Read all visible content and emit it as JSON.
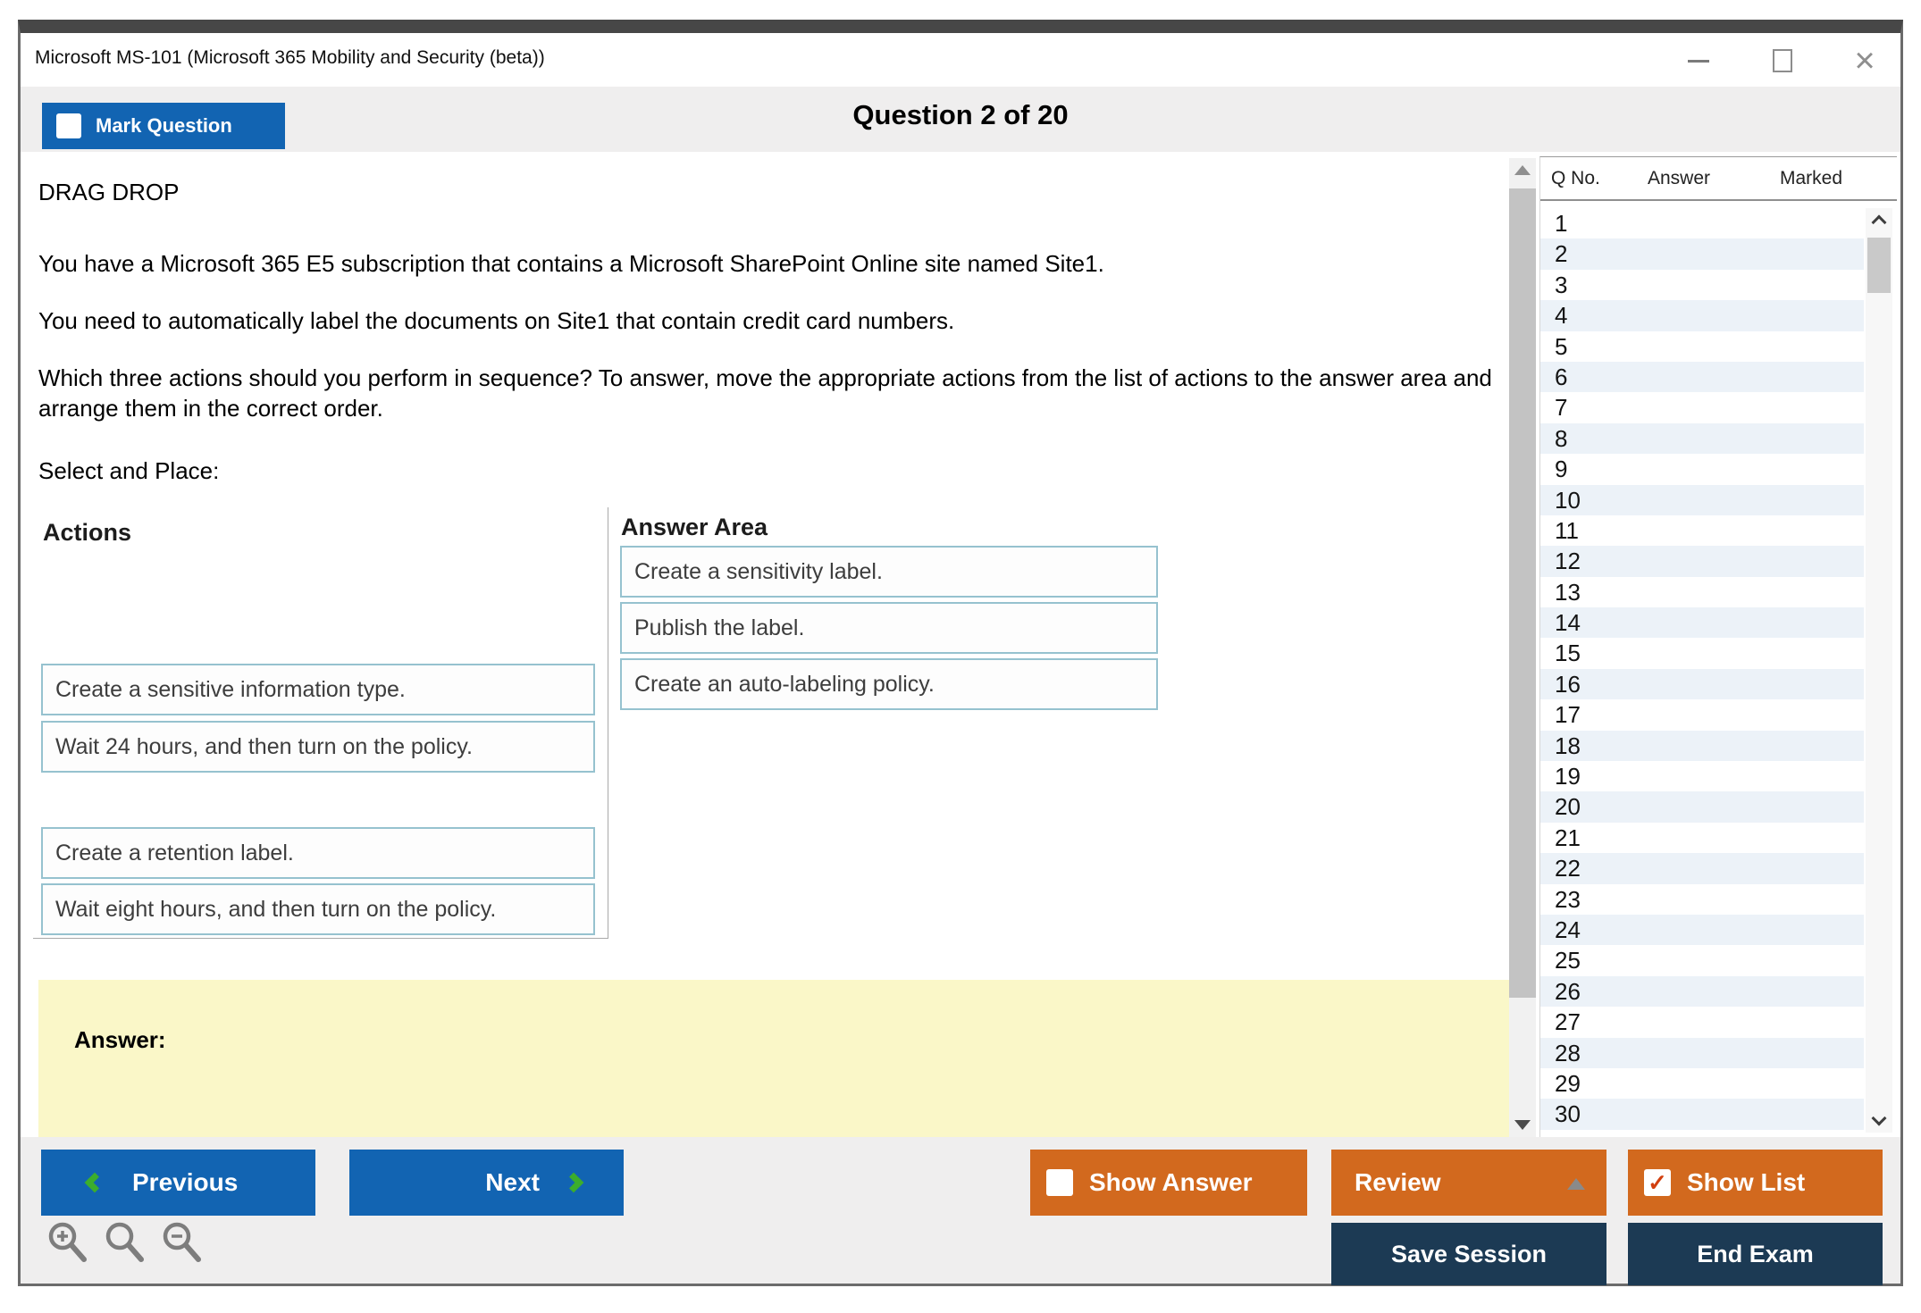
{
  "window": {
    "title": "Microsoft MS-101 (Microsoft 365 Mobility and Security (beta))"
  },
  "header": {
    "mark_question_label": "Mark Question",
    "question_counter": "Question 2 of 20"
  },
  "question": {
    "kind": "DRAG DROP",
    "p1": "You have a Microsoft 365 E5 subscription that contains a Microsoft SharePoint Online site named Site1.",
    "p2": "You need to automatically label the documents on Site1 that contain credit card numbers.",
    "p3": "Which three actions should you perform in sequence? To answer, move the appropriate actions from the list of actions to the answer area and arrange them in the correct order.",
    "select_place": "Select and Place:",
    "actions_title": "Actions",
    "answer_area_title": "Answer Area",
    "actions": [
      "Create a sensitive information type.",
      "Wait 24 hours, and then turn on the policy.",
      "Create a retention label.",
      "Wait eight hours, and then turn on the policy."
    ],
    "answers": [
      "Create a sensitivity label.",
      "Publish the label.",
      "Create an auto-labeling policy."
    ],
    "answer_label": "Answer:"
  },
  "qlist": {
    "headers": [
      "Q No.",
      "Answer",
      "Marked"
    ],
    "rows": [
      1,
      2,
      3,
      4,
      5,
      6,
      7,
      8,
      9,
      10,
      11,
      12,
      13,
      14,
      15,
      16,
      17,
      18,
      19,
      20,
      21,
      22,
      23,
      24,
      25,
      26,
      27,
      28,
      29,
      30
    ]
  },
  "footer": {
    "previous": "Previous",
    "next": "Next",
    "show_answer": "Show Answer",
    "review": "Review",
    "show_list": "Show List",
    "save_session": "Save Session",
    "end_exam": "End Exam",
    "show_answer_checked": false,
    "show_list_checked": true
  },
  "colors": {
    "primary_blue": "#1264b2",
    "orange": "#d2691e",
    "navy": "#1c3a54",
    "green": "#3cae2c",
    "yellow": "#faf7c8",
    "box_border": "#96c2cf"
  }
}
